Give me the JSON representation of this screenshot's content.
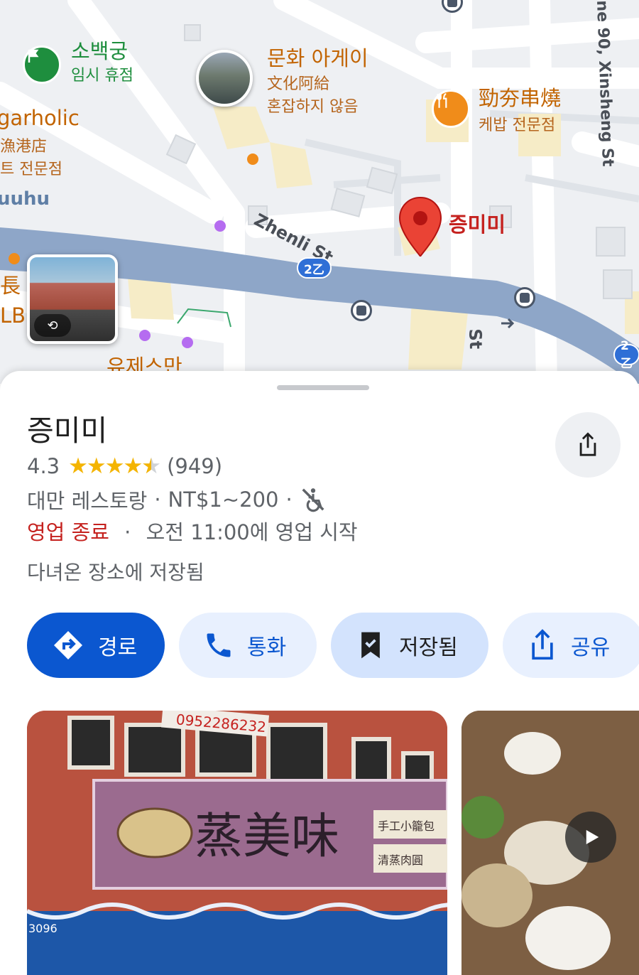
{
  "map": {
    "labels": {
      "poi1_name": "소백궁",
      "poi1_status": "임시 휴점",
      "poi2_name": "문화 아게이",
      "poi2_zh": "文化阿給",
      "poi2_status": "혼잡하지 않음",
      "poi3_name": "勁夯串燒",
      "poi3_category": "케밥 전문점",
      "left1": "garholic",
      "left2": "漁港店",
      "left3": "트 전문점",
      "left4": "uuhu",
      "left5": "長",
      "left6": "LB",
      "street1": "Zhenli St",
      "street2": "ne 90, Xinsheng St",
      "street3": "St",
      "bottom_label": "유제스만",
      "selected_pin_label": "증미미",
      "route_badge_1": "2乙",
      "route_badge_2": "2乙"
    },
    "icons": {
      "poi1": "flag-icon",
      "poi3": "restaurant-icon",
      "pin": "red-map-pin-icon",
      "bus": "bus-stop-icon",
      "streetview": "360-rotate-icon"
    },
    "street_view_badge": "⟲"
  },
  "place": {
    "name": "증미미",
    "rating": "4.3",
    "stars_full": "★★★★",
    "star_half": "★",
    "star_empty": "",
    "reviews": "(949)",
    "category": "대만 레스토랑",
    "separator": "·",
    "price": "NT$1~200",
    "accessibility_icon": "wheelchair-not-accessible-icon",
    "status": "영업 종료",
    "hours": "오전 11:00에 영업 시작",
    "saved_note": "다녀온 장소에 저장됨"
  },
  "actions": {
    "directions": "경로",
    "call": "통화",
    "saved": "저장됨",
    "share": "공유"
  },
  "photos": {
    "storefront_sign": "蒸美味",
    "storefront_side_1": "手工小籠包",
    "storefront_side_2": "清蒸肉圓",
    "banner_text": "0952286232",
    "awning_number": "3096"
  },
  "colors": {
    "primary": "#0b57d0",
    "closed_red": "#c5221f",
    "star": "#f4b400",
    "road": "#8ea6c8",
    "map_bg": "#eef0f3"
  }
}
